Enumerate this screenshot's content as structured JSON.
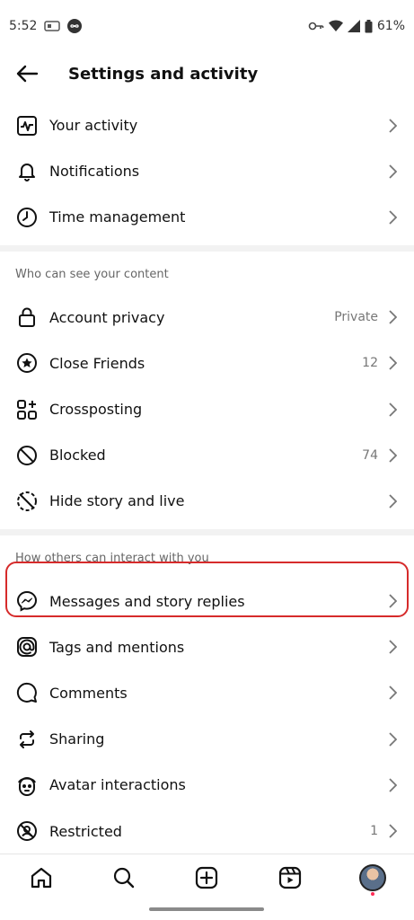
{
  "status": {
    "time": "5:52",
    "battery": "61%"
  },
  "header": {
    "title": "Settings and activity"
  },
  "group1": [
    {
      "label": "Your activity",
      "value": "",
      "icon": "activity-icon"
    },
    {
      "label": "Notifications",
      "value": "",
      "icon": "bell-icon"
    },
    {
      "label": "Time management",
      "value": "",
      "icon": "clock-icon"
    }
  ],
  "section2": {
    "title": "Who can see your content"
  },
  "group2": [
    {
      "label": "Account privacy",
      "value": "Private",
      "icon": "lock-icon"
    },
    {
      "label": "Close Friends",
      "value": "12",
      "icon": "star-circle-icon"
    },
    {
      "label": "Crossposting",
      "value": "",
      "icon": "grid-plus-icon"
    },
    {
      "label": "Blocked",
      "value": "74",
      "icon": "blocked-icon"
    },
    {
      "label": "Hide story and live",
      "value": "",
      "icon": "hide-story-icon"
    }
  ],
  "section3": {
    "title": "How others can interact with you"
  },
  "group3": [
    {
      "label": "Messages and story replies",
      "value": "",
      "icon": "messenger-icon"
    },
    {
      "label": "Tags and mentions",
      "value": "",
      "icon": "at-icon"
    },
    {
      "label": "Comments",
      "value": "",
      "icon": "comment-icon"
    },
    {
      "label": "Sharing",
      "value": "",
      "icon": "share-icon"
    },
    {
      "label": "Avatar interactions",
      "value": "",
      "icon": "avatar-face-icon"
    },
    {
      "label": "Restricted",
      "value": "1",
      "icon": "restricted-icon"
    }
  ],
  "nav": [
    "home-icon",
    "search-icon",
    "create-icon",
    "reels-icon",
    "profile-avatar"
  ],
  "colors": {
    "highlight": "#d62b2b",
    "notification_dot": "#ff2b55"
  }
}
